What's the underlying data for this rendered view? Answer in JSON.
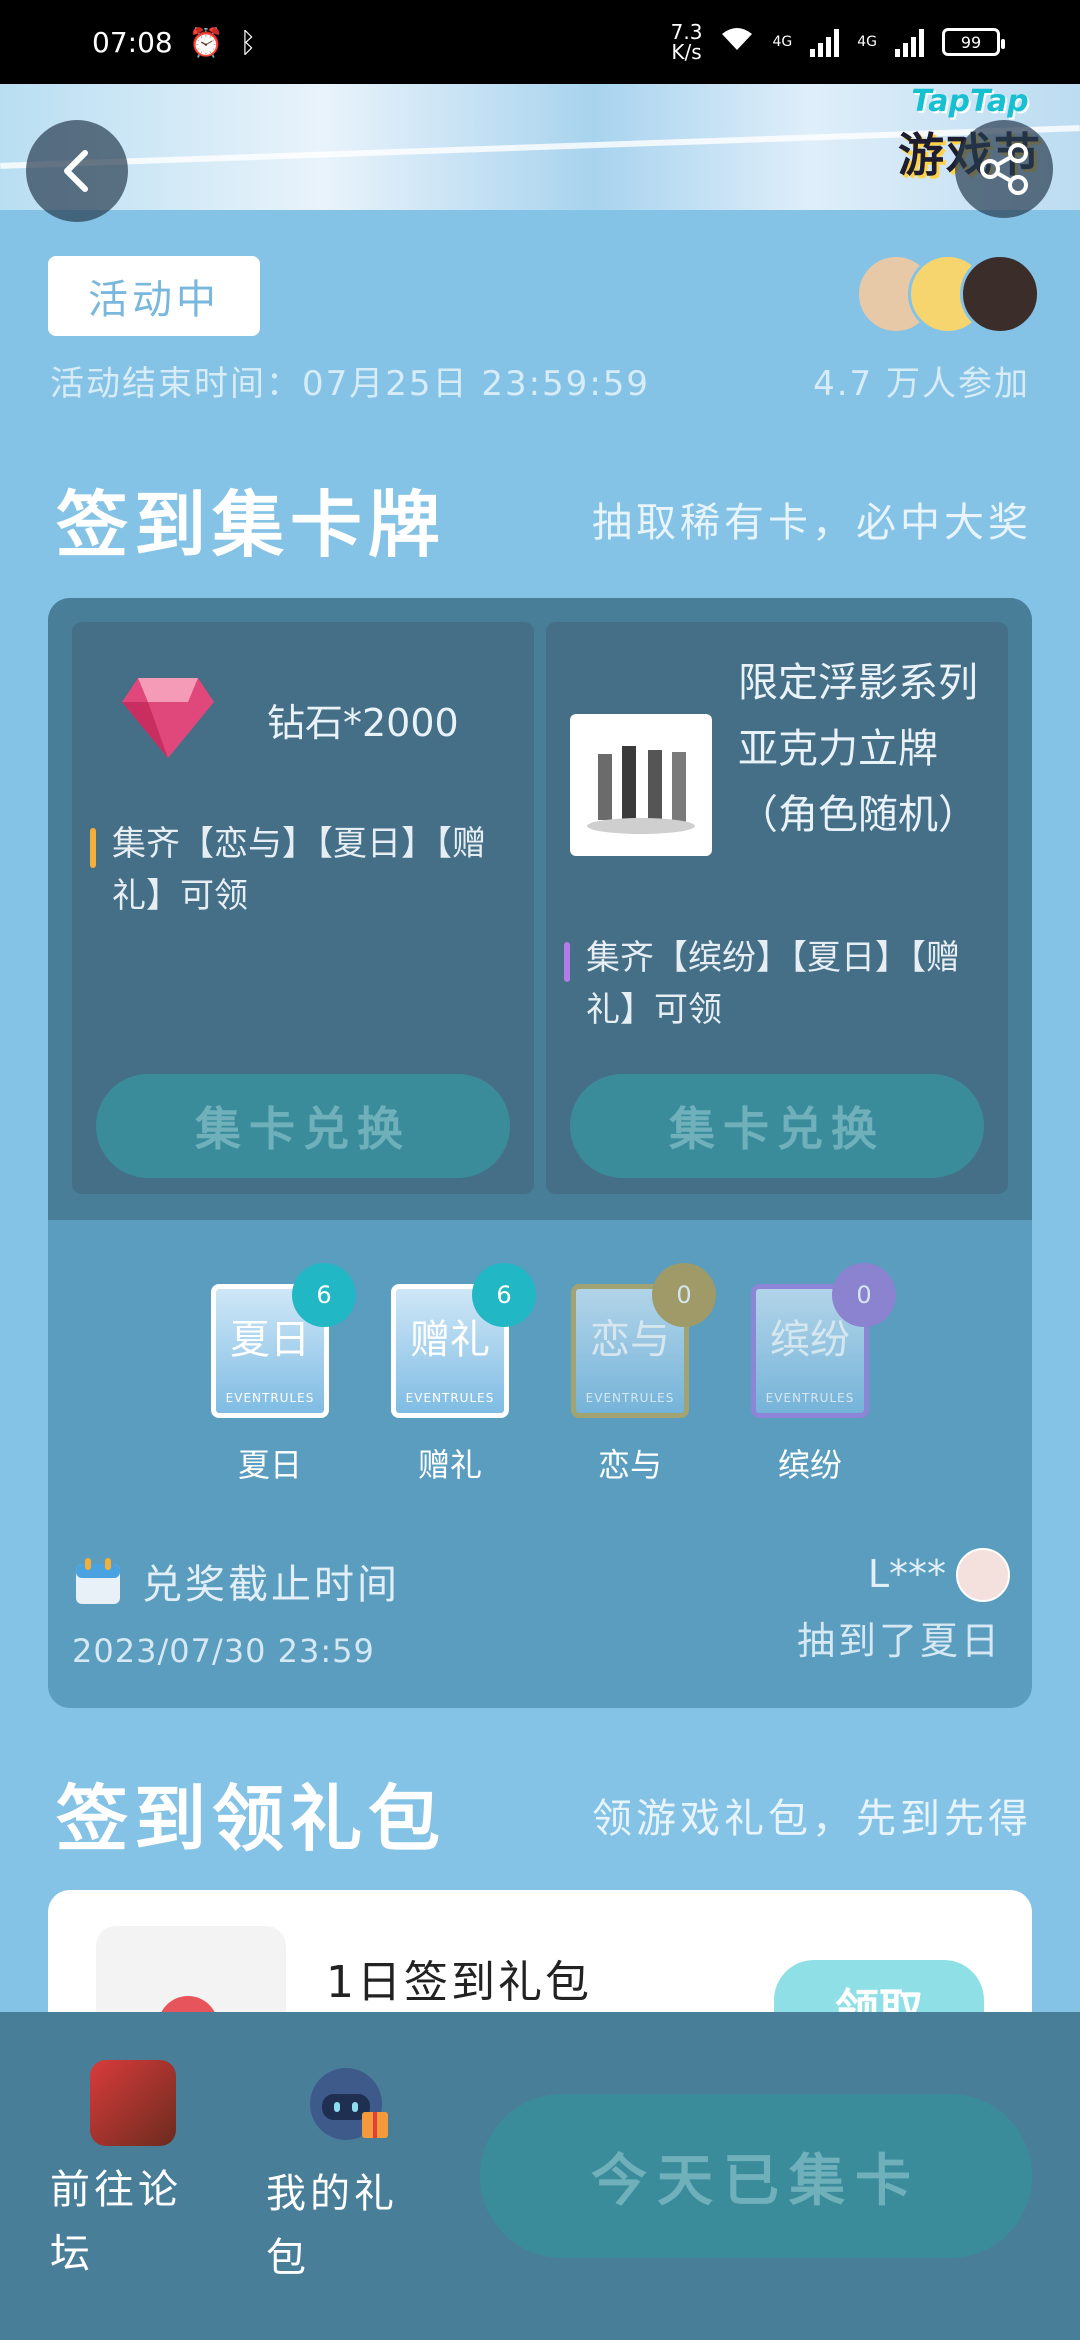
{
  "status_bar": {
    "time": "07:08",
    "net_speed_value": "7.3",
    "net_speed_unit": "K/s",
    "network1": "4G",
    "network2": "4G",
    "battery": "99"
  },
  "banner": {
    "logo_top": "TapTap",
    "logo_bottom": "游戏节"
  },
  "activity": {
    "status_badge": "活动中",
    "end_time": "活动结束时间：07月25日 23:59:59",
    "participants": "4.7 万人参加"
  },
  "section_cards": {
    "title": "签到集卡牌",
    "subtitle": "抽取稀有卡，必中大奖"
  },
  "prizes": [
    {
      "name": "钻石*2000",
      "requirement": "集齐【恋与】【夏日】【赠礼】可领",
      "button": "集卡兑换"
    },
    {
      "name": "限定浮影系列亚克力立牌（角色随机）",
      "requirement": "集齐【缤纷】【夏日】【赠礼】可领",
      "button": "集卡兑换"
    }
  ],
  "cards": [
    {
      "face": "夏日",
      "label": "夏日",
      "count": "6",
      "badge_color": "#22b7c4",
      "footer": "EVENTRULES"
    },
    {
      "face": "赠礼",
      "label": "赠礼",
      "count": "6",
      "badge_color": "#22b7c4",
      "footer": "EVENTRULES"
    },
    {
      "face": "恋与",
      "label": "恋与",
      "count": "0",
      "badge_color": "#b69a4a",
      "footer": "EVENTRULES"
    },
    {
      "face": "缤纷",
      "label": "缤纷",
      "count": "0",
      "badge_color": "#9c7ad6",
      "footer": "EVENTRULES"
    }
  ],
  "deadline": {
    "label": "兑奖截止时间",
    "value": "2023/07/30 23:59"
  },
  "feed": {
    "user": "L***",
    "message": "抽到了夏日"
  },
  "section_gifts": {
    "title": "签到领礼包",
    "subtitle": "领游戏礼包，先到先得"
  },
  "gift": {
    "name": "1日签到礼包",
    "button": "领取"
  },
  "bottom_bar": {
    "forum_label": "前往论坛",
    "mygift_label": "我的礼包",
    "collect_button": "今天已集卡"
  }
}
